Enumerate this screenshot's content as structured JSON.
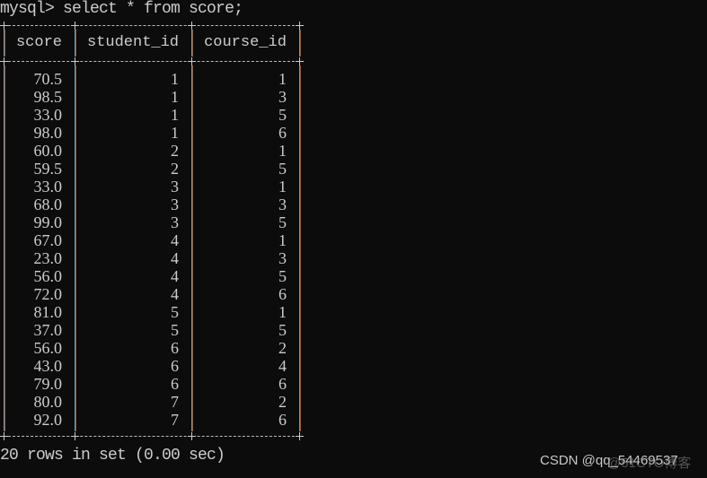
{
  "terminal": {
    "prompt": "mysql>",
    "command": "select * from score;",
    "columns": [
      "score",
      "student_id",
      "course_id"
    ],
    "rows": [
      [
        "70.5",
        "1",
        "1"
      ],
      [
        "98.5",
        "1",
        "3"
      ],
      [
        "33.0",
        "1",
        "5"
      ],
      [
        "98.0",
        "1",
        "6"
      ],
      [
        "60.0",
        "2",
        "1"
      ],
      [
        "59.5",
        "2",
        "5"
      ],
      [
        "33.0",
        "3",
        "1"
      ],
      [
        "68.0",
        "3",
        "3"
      ],
      [
        "99.0",
        "3",
        "5"
      ],
      [
        "67.0",
        "4",
        "1"
      ],
      [
        "23.0",
        "4",
        "3"
      ],
      [
        "56.0",
        "4",
        "5"
      ],
      [
        "72.0",
        "4",
        "6"
      ],
      [
        "81.0",
        "5",
        "1"
      ],
      [
        "37.0",
        "5",
        "5"
      ],
      [
        "56.0",
        "6",
        "2"
      ],
      [
        "43.0",
        "6",
        "4"
      ],
      [
        "79.0",
        "6",
        "6"
      ],
      [
        "80.0",
        "7",
        "2"
      ],
      [
        "92.0",
        "7",
        "6"
      ]
    ],
    "result_summary": "20 rows in set (0.00 sec)"
  },
  "watermark": {
    "text": "CSDN @qq_54469537",
    "overlay_text": "@51CTO博客"
  }
}
